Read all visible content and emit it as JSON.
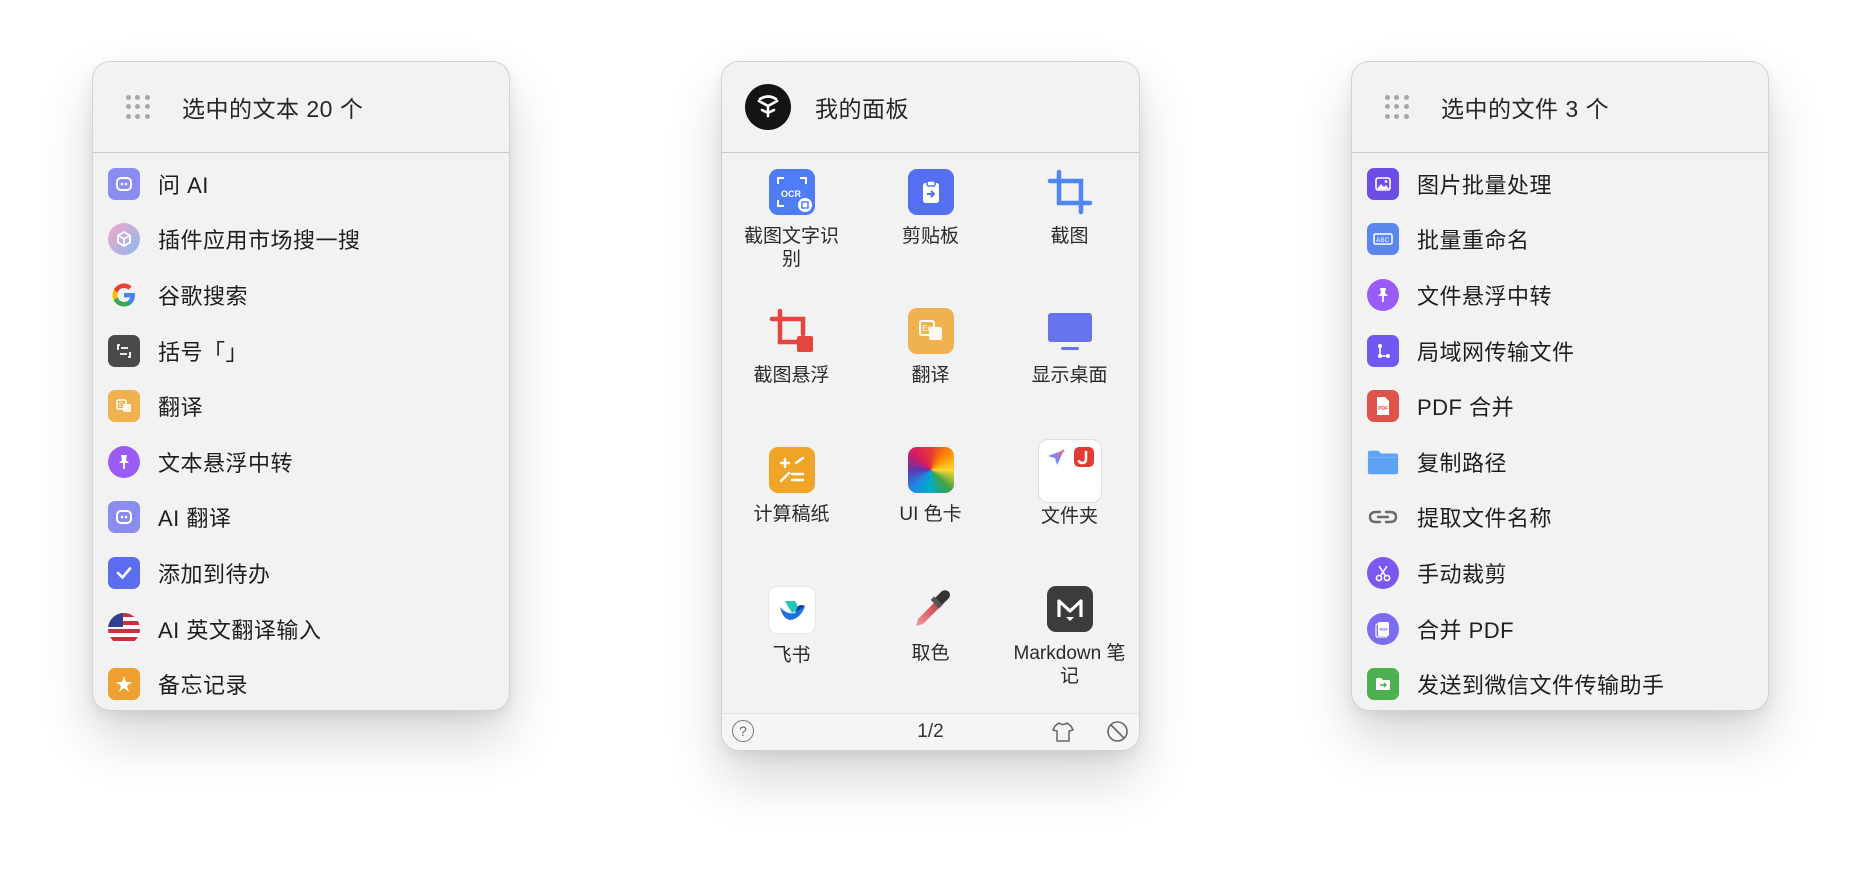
{
  "text_panel": {
    "title": "选中的文本 20 个",
    "items": [
      {
        "label": "问 AI",
        "icon": "robot-icon",
        "color": "#8b8cf2"
      },
      {
        "label": "插件应用市场搜一搜",
        "icon": "plugin-store-icon",
        "color": "#9aa4f0"
      },
      {
        "label": "谷歌搜索",
        "icon": "google-icon",
        "color": "#ffffff"
      },
      {
        "label": "括号「」",
        "icon": "bracket-icon",
        "color": "#4a4a4a"
      },
      {
        "label": "翻译",
        "icon": "translate-icon",
        "color": "#f0b24f"
      },
      {
        "label": "文本悬浮中转",
        "icon": "pin-icon",
        "color": "#9b5cf5"
      },
      {
        "label": "AI 翻译",
        "icon": "robot-icon",
        "color": "#8b8cf2"
      },
      {
        "label": "添加到待办",
        "icon": "checkmark-icon",
        "color": "#5b6ef0"
      },
      {
        "label": "AI 英文翻译输入",
        "icon": "us-flag-icon",
        "color": "#c8323c"
      },
      {
        "label": "备忘记录",
        "icon": "memo-icon",
        "color": "#f0a030"
      }
    ]
  },
  "board_panel": {
    "title": "我的面板",
    "items": [
      {
        "label": "截图文字识别",
        "icon": "ocr-icon",
        "color": "#4f7df5"
      },
      {
        "label": "剪贴板",
        "icon": "clipboard-icon",
        "color": "#5470f0"
      },
      {
        "label": "截图",
        "icon": "crop-icon",
        "color": "#4f86f5"
      },
      {
        "label": "截图悬浮",
        "icon": "crop-float-icon",
        "color": "#e5453f"
      },
      {
        "label": "翻译",
        "icon": "translate-icon",
        "color": "#f0b24f"
      },
      {
        "label": "显示桌面",
        "icon": "desktop-icon",
        "color": "#6673ea"
      },
      {
        "label": "计算稿纸",
        "icon": "calculator-icon",
        "color": "#f0a428"
      },
      {
        "label": "UI 色卡",
        "icon": "color-card-icon",
        "color": "#888888"
      },
      {
        "label": "文件夹",
        "icon": "folder-apps-icon",
        "color": "#ffffff"
      },
      {
        "label": "飞书",
        "icon": "feishu-icon",
        "color": "#ffffff"
      },
      {
        "label": "取色",
        "icon": "eyedropper-icon",
        "color": "#c8585c"
      },
      {
        "label": "Markdown 笔记",
        "icon": "markdown-icon",
        "color": "#3c3c3c"
      }
    ],
    "footer": {
      "help_icon": "help-icon",
      "page": "1/2",
      "theme_icon": "shirt-icon",
      "disable_icon": "forbid-icon"
    }
  },
  "files_panel": {
    "title": "选中的文件 3 个",
    "items": [
      {
        "label": "图片批量处理",
        "icon": "image-batch-icon",
        "color": "#6c4ee6"
      },
      {
        "label": "批量重命名",
        "icon": "rename-icon",
        "color": "#5b86ef"
      },
      {
        "label": "文件悬浮中转",
        "icon": "pin-icon",
        "color": "#9b5cf5"
      },
      {
        "label": "局域网传输文件",
        "icon": "lan-transfer-icon",
        "color": "#7258f0"
      },
      {
        "label": "PDF 合并",
        "icon": "pdf-icon",
        "color": "#e0534c"
      },
      {
        "label": "复制路径",
        "icon": "folder-icon",
        "color": "#5ea2f5"
      },
      {
        "label": "提取文件名称",
        "icon": "link-icon",
        "color": "#6b6b6b"
      },
      {
        "label": "手动裁剪",
        "icon": "scissors-icon",
        "color": "#7c58f0"
      },
      {
        "label": "合并 PDF",
        "icon": "merge-pdf-icon",
        "color": "#7c6cf2"
      },
      {
        "label": "发送到微信文件传输助手",
        "icon": "wechat-transfer-icon",
        "color": "#4caf50"
      }
    ]
  }
}
